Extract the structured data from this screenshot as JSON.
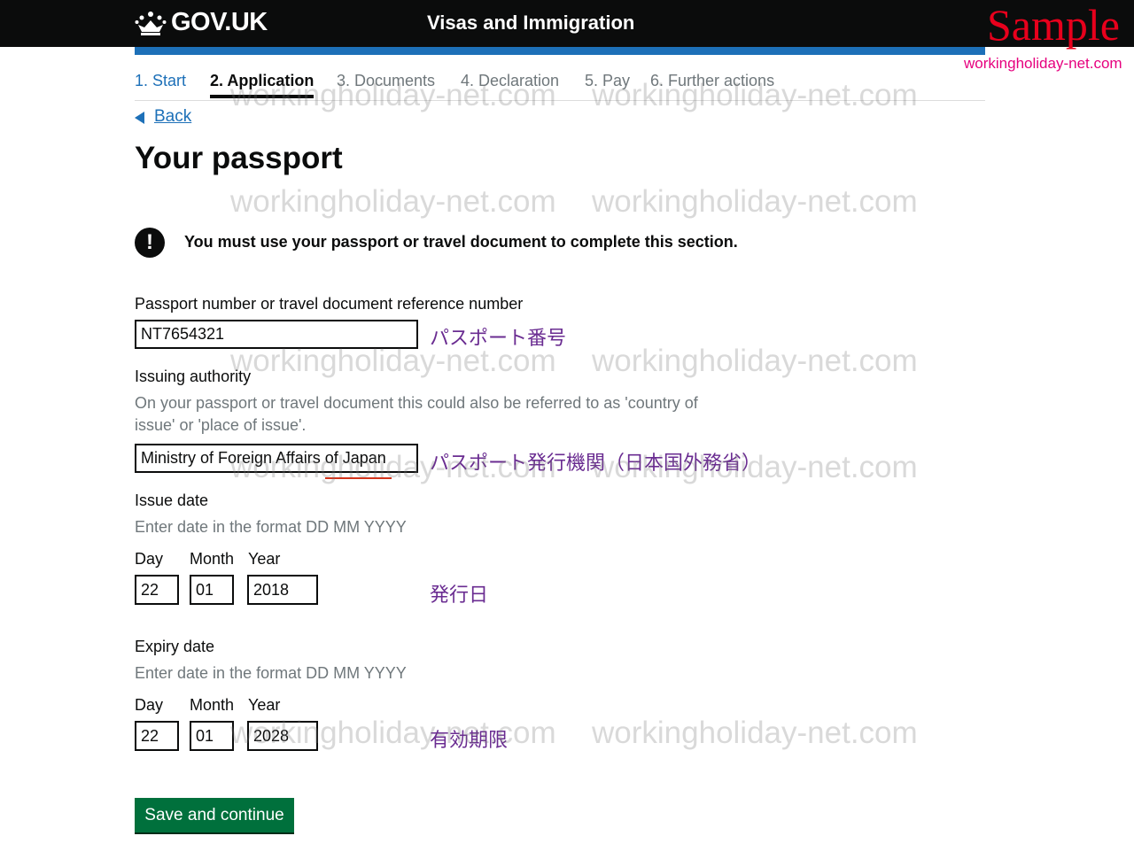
{
  "header": {
    "logo_text": "GOV.UK",
    "service_name": "Visas and Immigration",
    "sample_label": "Sample",
    "site_url": "workingholiday-net.com"
  },
  "steps": [
    {
      "label": "1. Start",
      "state": "done"
    },
    {
      "label": "2. Application",
      "state": "current"
    },
    {
      "label": "3. Documents",
      "state": "future"
    },
    {
      "label": "4. Declaration",
      "state": "future"
    },
    {
      "label": "5. Pay",
      "state": "future"
    },
    {
      "label": "6. Further actions",
      "state": "future"
    }
  ],
  "back_label": "Back",
  "page_title": "Your passport",
  "warning": "You must use your passport or travel document to complete this section.",
  "passport_number": {
    "label": "Passport number or travel document reference number",
    "value": "NT7654321",
    "annotation": "パスポート番号"
  },
  "issuing_authority": {
    "label": "Issuing authority",
    "hint_line1": "On your passport or travel document this could also be referred to as 'country of",
    "hint_line2": "issue' or 'place of issue'.",
    "value": "Ministry of Foreign Affairs of Japan",
    "annotation": "パスポート発行機関（日本国外務省）"
  },
  "issue_date": {
    "label": "Issue date",
    "hint": "Enter date in the format DD MM YYYY",
    "day_label": "Day",
    "month_label": "Month",
    "year_label": "Year",
    "day": "22",
    "month": "01",
    "year": "2018",
    "annotation": "発行日"
  },
  "expiry_date": {
    "label": "Expiry date",
    "hint": "Enter date in the format DD MM YYYY",
    "day_label": "Day",
    "month_label": "Month",
    "year_label": "Year",
    "day": "22",
    "month": "01",
    "year": "2028",
    "annotation": "有効期限"
  },
  "save_button": "Save and continue",
  "watermark_text": "workingholiday-net.com",
  "colors": {
    "header_bg": "#0b0c0c",
    "accent_blue": "#1d70b8",
    "button_green": "#00703c",
    "sample_red": "#e8001c",
    "annotation_purple": "#6a2c91"
  }
}
